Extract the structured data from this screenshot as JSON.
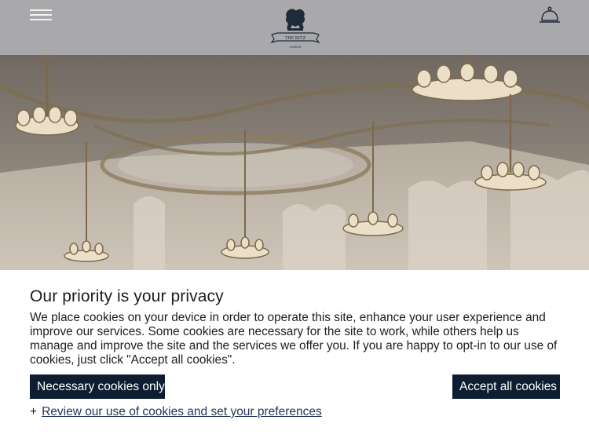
{
  "header": {
    "logo_text": "THE RITZ",
    "logo_subtext": "LONDON",
    "menu_icon": "hamburger-menu-icon",
    "concierge_icon": "service-bell-icon"
  },
  "hero": {
    "image_alt": "Ornate ballroom with gilded chandeliers"
  },
  "cookie_banner": {
    "title": "Our priority is your privacy",
    "body": "We place cookies on your device in order to operate this site, enhance your user experience and improve our services. Some cookies are necessary for the site to work, while others help us manage and improve the site and the services we offer you. If you are happy to opt-in to our use of cookies, just click \"Accept all cookies\".",
    "necessary_label": "Necessary cookies only",
    "accept_label": "Accept all cookies",
    "review_prefix": "+",
    "review_label": "Review our use of cookies and set your preferences"
  },
  "colors": {
    "header_bg": "#a9a9ab",
    "button_bg": "#0d1e33",
    "text": "#1d1d1d"
  }
}
